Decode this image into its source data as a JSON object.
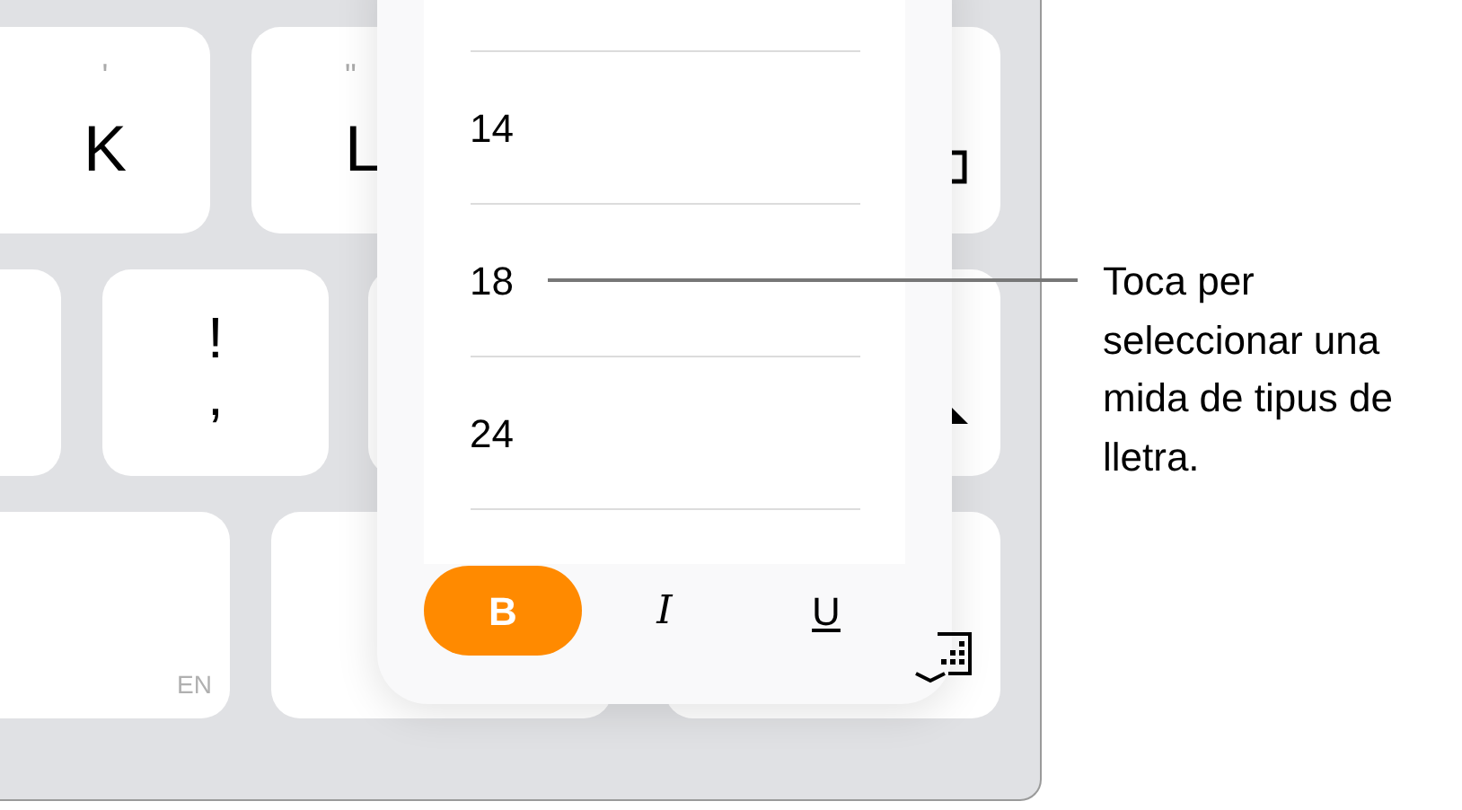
{
  "keyboard": {
    "keys": [
      {
        "top": "'",
        "main": "K"
      },
      {
        "top": "\"",
        "main": "L"
      },
      {
        "top": "!",
        "main": ","
      },
      {
        "corner": "EN"
      }
    ]
  },
  "font_size_menu": {
    "sizes": [
      {
        "label": "14"
      },
      {
        "label": "18"
      },
      {
        "label": "24"
      }
    ],
    "styles": [
      {
        "label": "B",
        "kind": "bold",
        "selected": true
      },
      {
        "label": "I",
        "kind": "italic",
        "selected": false
      },
      {
        "label": "U",
        "kind": "underline",
        "selected": false
      }
    ]
  },
  "callout": {
    "text": "Toca per seleccionar una mida de tipus de lletra."
  }
}
